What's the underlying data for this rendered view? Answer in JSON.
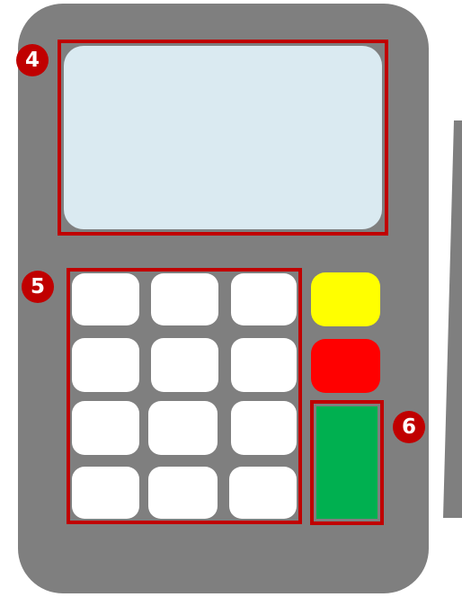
{
  "colors": {
    "device_body": "#7f7f7f",
    "screen": "#daeaf1",
    "highlight_border": "#c00000",
    "callout_fill": "#c00000",
    "callout_text": "#ffffff",
    "key": "#ffffff",
    "function_key_top": "#ffff00",
    "function_key_middle": "#ff0000",
    "function_key_bottom": "#00b050"
  },
  "callouts": {
    "screen": "4",
    "keypad": "5",
    "confirm_key": "6"
  },
  "keypad": {
    "rows": 4,
    "columns": 3
  }
}
